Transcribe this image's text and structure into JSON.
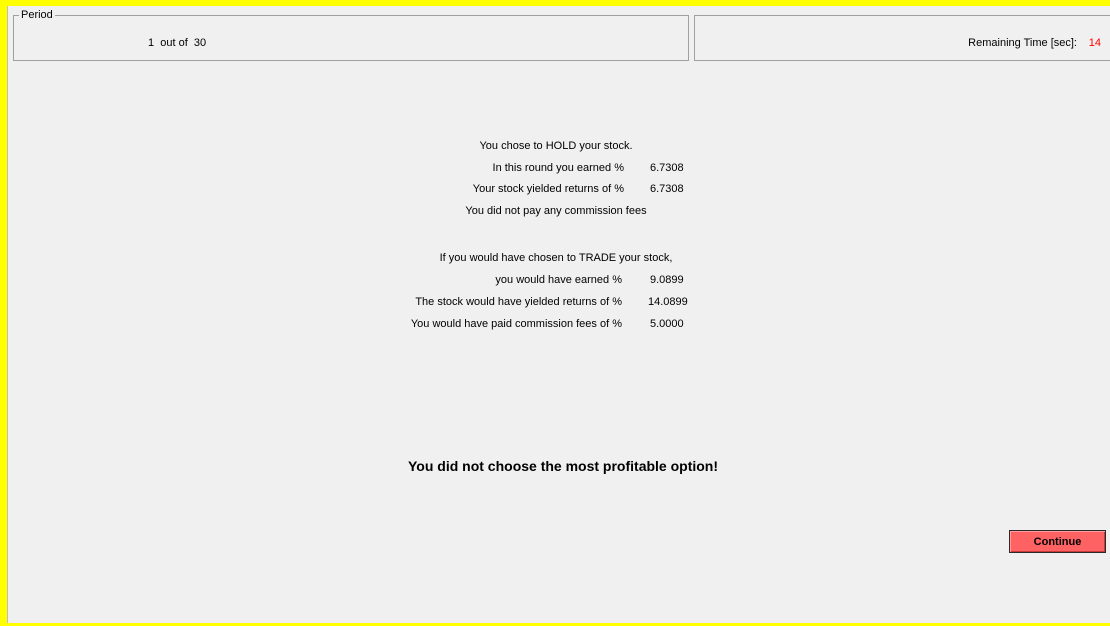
{
  "period": {
    "legend": "Period",
    "value": "1  out of  30"
  },
  "timer": {
    "label": "Remaining Time [sec]:",
    "value": "14",
    "value_color": "#ff0000"
  },
  "hold_section": {
    "intro": "You chose to HOLD your stock.",
    "earned_label": "In this round you earned %",
    "earned_value": "6.7308",
    "returns_label": "Your stock yielded returns of %",
    "returns_value": "6.7308",
    "commission_text": "You did not pay any commission fees"
  },
  "trade_section": {
    "intro": "If you would have chosen to TRADE your stock,",
    "earned_label": "you would have earned %",
    "earned_value": "9.0899",
    "returns_label": "The stock would have yielded returns of %",
    "returns_value": "14.0899",
    "commission_label": "You would have paid commission fees of %",
    "commission_value": "5.0000"
  },
  "verdict": "You did not choose the most profitable option!",
  "continue_button": {
    "label": "Continue",
    "color": "#ff6262"
  },
  "frame_accent_color": "#ffff00"
}
